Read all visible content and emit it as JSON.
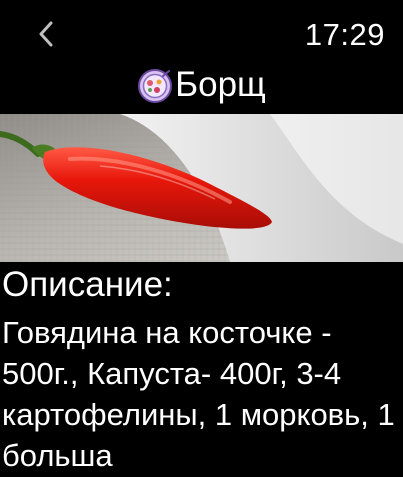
{
  "header": {
    "back_icon": "chevron-left-icon",
    "time": "17:29"
  },
  "recipe": {
    "icon": "soup-bowl-icon",
    "title": "Борщ",
    "image": "red-chili-pepper-photo",
    "section_label": "Описание:",
    "description": "Говядина на косточке - 500г., Капуста- 400г, 3-4 картофелины, 1 морковь, 1 больша"
  },
  "colors": {
    "background": "#000000",
    "text": "#ffffff",
    "back_icon": "#bfbfbf",
    "icon_bowl": "#c9a7e6",
    "pepper": "#e21a10"
  }
}
